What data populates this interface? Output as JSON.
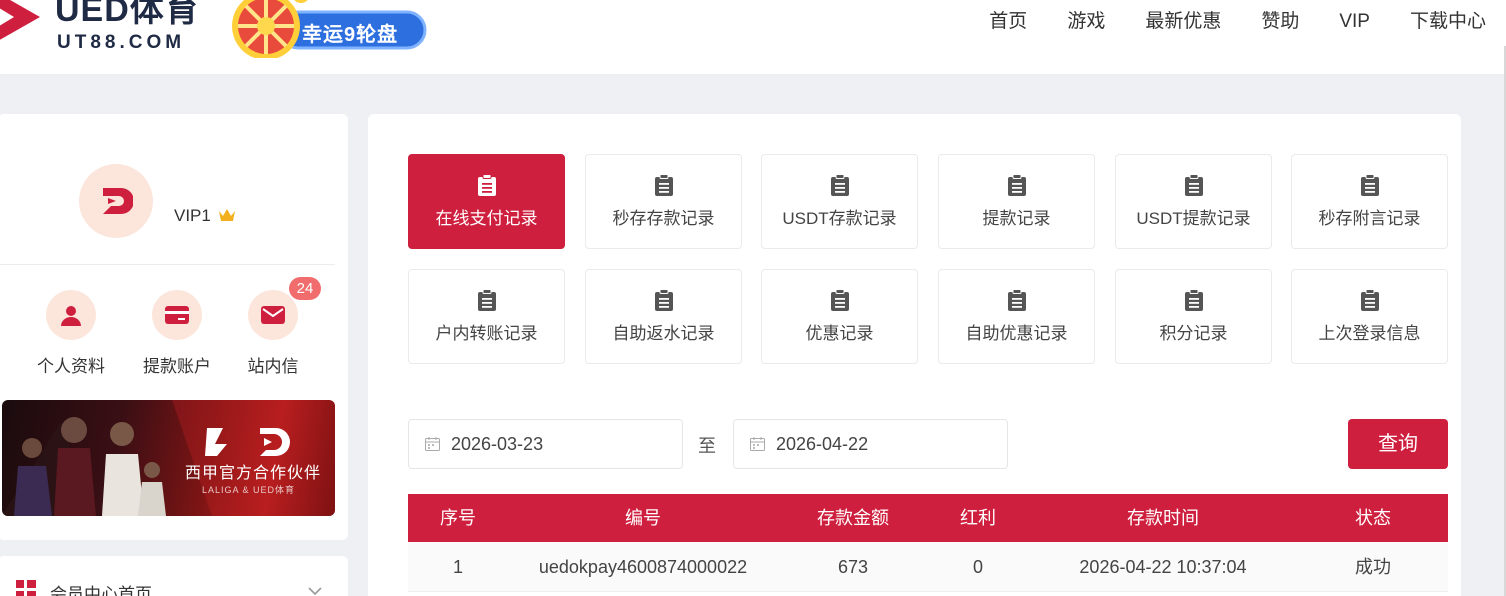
{
  "header": {
    "brand": "UED体育",
    "domain": "UT88.COM",
    "promo_banner": "幸运9轮盘",
    "nav": [
      "首页",
      "游戏",
      "最新优惠",
      "赞助",
      "VIP",
      "下载中心"
    ]
  },
  "profile": {
    "vip_level": "VIP1",
    "quick_links": [
      {
        "label": "个人资料",
        "icon": "user-icon"
      },
      {
        "label": "提款账户",
        "icon": "card-icon"
      },
      {
        "label": "站内信",
        "icon": "mail-icon"
      }
    ],
    "message_badge": "24",
    "sponsor_banner": {
      "title": "西甲官方合作伙伴",
      "subtitle": "LALIGA & UED体育"
    }
  },
  "menu": {
    "first_item": "会员中心首页"
  },
  "record_tabs": [
    "在线支付记录",
    "秒存存款记录",
    "USDT存款记录",
    "提款记录",
    "USDT提款记录",
    "秒存附言记录",
    "户内转账记录",
    "自助返水记录",
    "优惠记录",
    "自助优惠记录",
    "积分记录",
    "上次登录信息"
  ],
  "active_tab": "在线支付记录",
  "filter": {
    "start_date": "2026-03-23",
    "separator": "至",
    "end_date": "2026-04-22",
    "query_label": "查询"
  },
  "table": {
    "headers": [
      "序号",
      "编号",
      "存款金额",
      "红利",
      "存款时间",
      "状态"
    ],
    "rows": [
      [
        "1",
        "uedokpay4600874000022",
        "673",
        "0",
        "2026-04-22 10:37:04",
        "成功"
      ]
    ]
  },
  "colors": {
    "accent": "#cf1f3e",
    "icon_bg": "#fce6dc",
    "page_bg": "#eef0f4"
  }
}
